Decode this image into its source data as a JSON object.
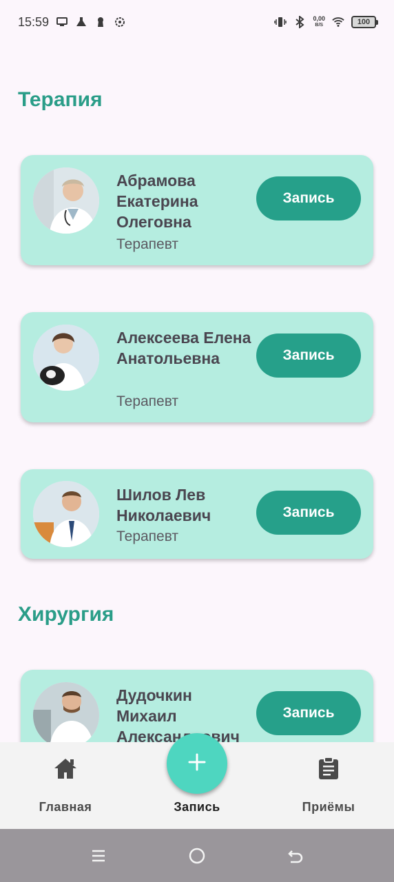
{
  "status_bar": {
    "time": "15:59",
    "net_speed_value": "0,00",
    "net_speed_unit": "B/S",
    "battery": "100"
  },
  "sections": [
    {
      "title": "Терапия"
    },
    {
      "title": "Хирургия"
    }
  ],
  "doctors": [
    {
      "name": "Абрамова Екатерина Олеговна",
      "specialty": "Терапевт",
      "button": "Запись"
    },
    {
      "name": "Алексеева Елена Анатольевна",
      "specialty": "Терапевт",
      "button": "Запись"
    },
    {
      "name": "Шилов Лев Николаевич",
      "specialty": "Терапевт",
      "button": "Запись"
    },
    {
      "name": "Дудочкин Михаил Александрович",
      "specialty": "",
      "button": "Запись"
    }
  ],
  "bottom_nav": {
    "home_label": "Главная",
    "booking_label": "Запись",
    "appointments_label": "Приёмы"
  },
  "colors": {
    "accent": "#2a9d88",
    "card": "#b5ede0",
    "button": "#26a08a",
    "fab": "#4ed6c0"
  }
}
